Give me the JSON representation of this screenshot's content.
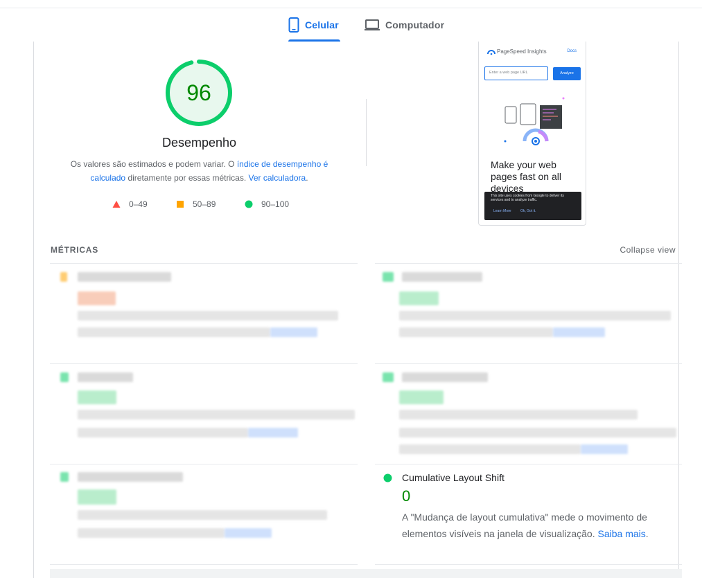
{
  "tabs": {
    "mobile_label": "Celular",
    "desktop_label": "Computador"
  },
  "score": {
    "value": "96",
    "value_fraction": 0.96,
    "label": "Desempenho",
    "desc_part1": "Os valores são estimados e podem variar. O ",
    "desc_link1": "índice de desempenho é calculado",
    "desc_part2": " diretamente por essas métricas. ",
    "desc_link2": "Ver calculadora",
    "desc_part3": "."
  },
  "legend": {
    "fail": "0–49",
    "average": "50–89",
    "pass": "90–100"
  },
  "colors": {
    "accent": "#1a73e8",
    "pass": "#0cce6b",
    "average": "#ffa400",
    "fail": "#ff4e42",
    "pass_text": "#008800"
  },
  "screenshot": {
    "brand": "PageSpeed Insights",
    "docs": "Docs",
    "input_placeholder": "Enter a web page URL",
    "analyze": "Analyze",
    "headline": "Make your web pages fast on all devices",
    "cookie_text": "This site uses cookies from Google to deliver its services and to analyze traffic.",
    "learn_more": "Learn More",
    "ok": "Ok, Got it."
  },
  "metrics": {
    "section_title": "MÉTRICAS",
    "collapse_label": "Collapse view",
    "cls": {
      "title": "Cumulative Layout Shift",
      "value": "0",
      "description": "A \"Mudança de layout cumulativa\" mede o movimento de elementos visíveis na janela de visualização. ",
      "learn_more": "Saiba mais",
      "period": "."
    }
  }
}
